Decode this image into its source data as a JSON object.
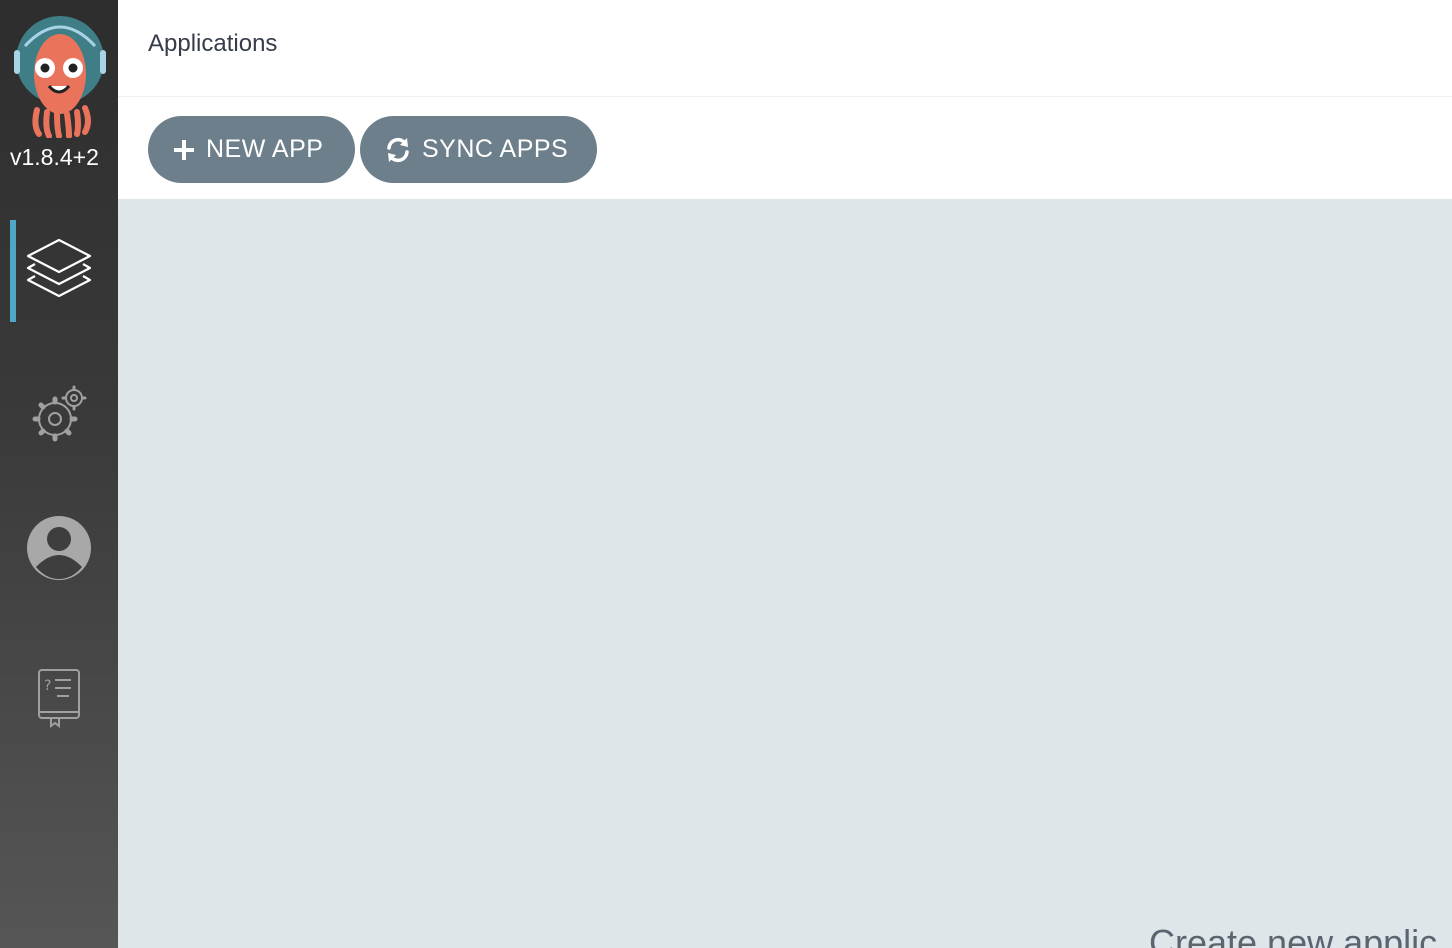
{
  "sidebar": {
    "version": "v1.8.4+2",
    "nav": [
      {
        "id": "applications",
        "icon": "layers-icon",
        "active": true
      },
      {
        "id": "settings",
        "icon": "gears-icon",
        "active": false
      },
      {
        "id": "user-info",
        "icon": "user-icon",
        "active": false
      },
      {
        "id": "documentation",
        "icon": "docs-book-icon",
        "active": false
      }
    ]
  },
  "header": {
    "title": "Applications"
  },
  "toolbar": {
    "new_app_label": "NEW APP",
    "sync_apps_label": "SYNC APPS"
  },
  "main": {
    "empty_message": "Create new applic"
  },
  "colors": {
    "accent": "#4fa7c8",
    "button": "#6d7f8b",
    "content_bg": "#dee6ea",
    "sidebar_bg": "#333333"
  }
}
